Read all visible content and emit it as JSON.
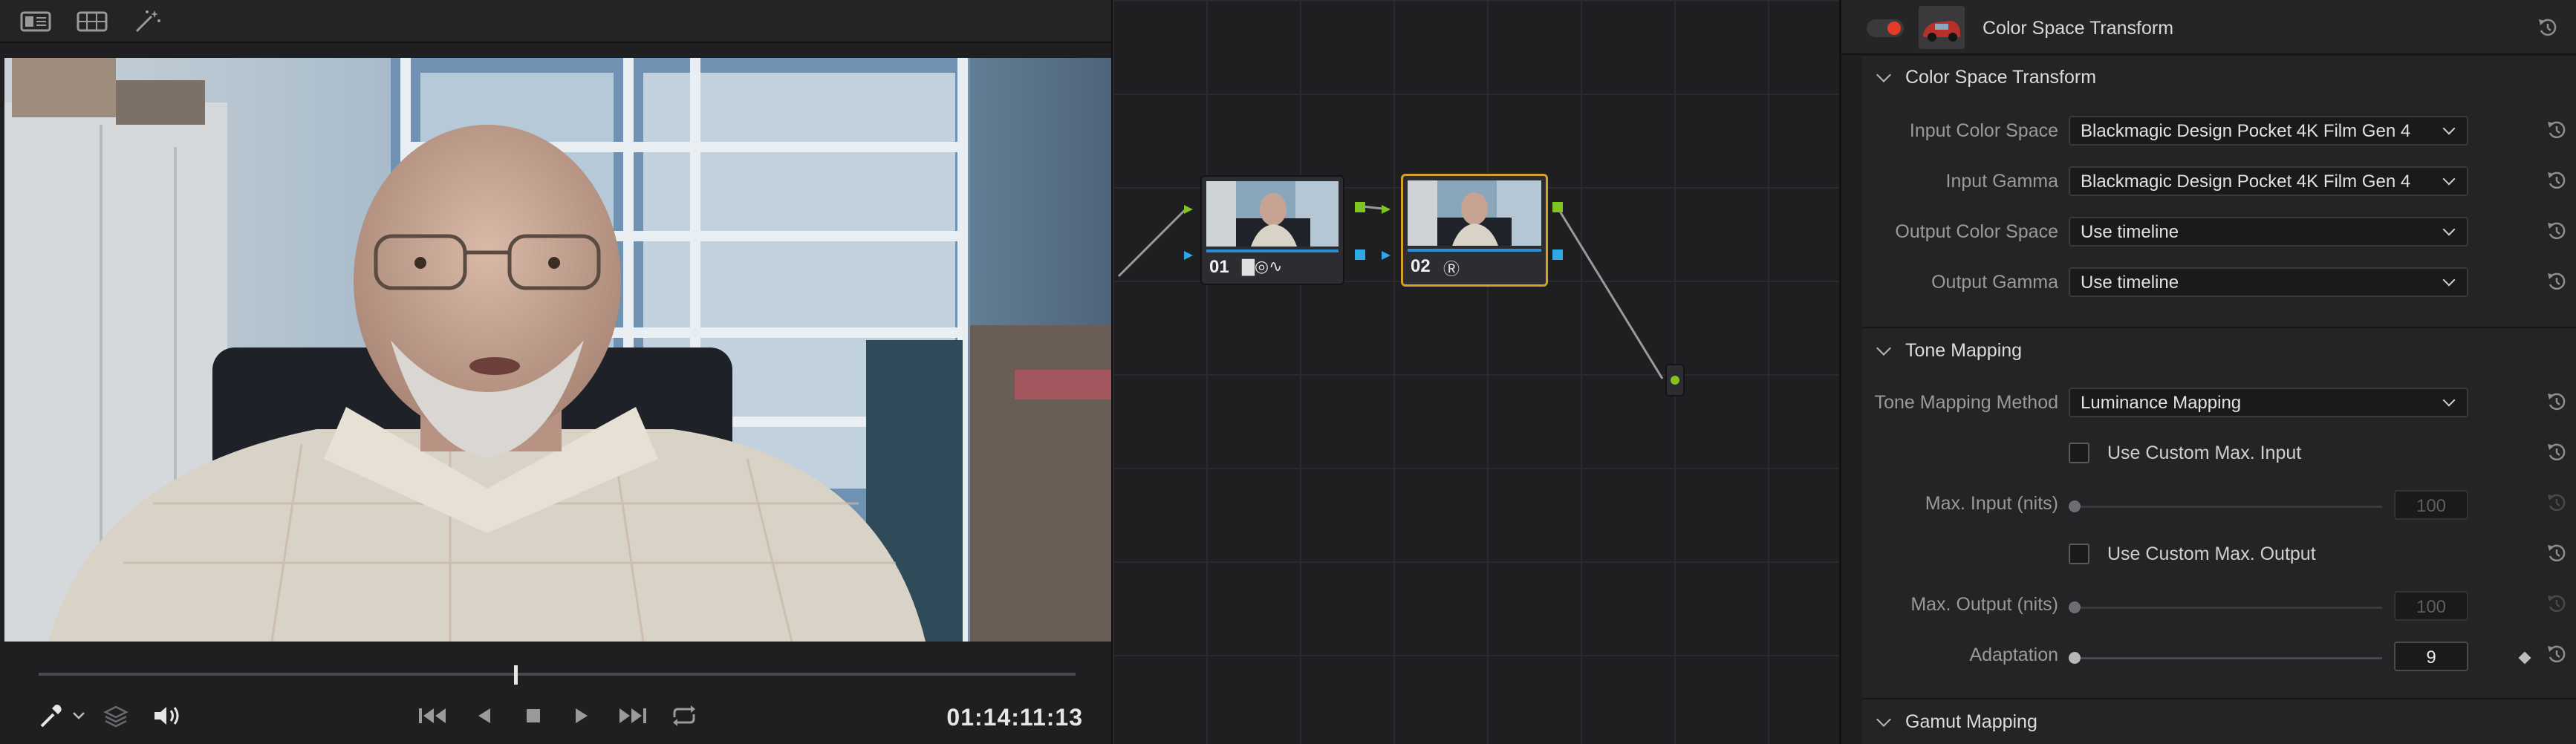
{
  "viewer": {
    "toolbar_icons": [
      "single-viewer-icon",
      "grid-viewer-icon",
      "magic-wand-icon"
    ],
    "timecode": "01:14:11:13",
    "transport_icons": [
      "eyedropper-icon",
      "layers-icon",
      "speaker-icon",
      "skip-to-start-icon",
      "step-back-icon",
      "stop-icon",
      "play-icon",
      "skip-to-end-icon",
      "loop-icon"
    ],
    "playhead_position": 0.46
  },
  "nodes": [
    {
      "label": "01",
      "icons": "▇◎∿",
      "selected": false
    },
    {
      "label": "02",
      "icons": "Ⓡ",
      "selected": true
    }
  ],
  "inspector": {
    "title": "Color Space Transform",
    "toggle_on": true,
    "sections": {
      "cst": {
        "title": "Color Space Transform",
        "input_color_space_label": "Input Color Space",
        "input_color_space_value": "Blackmagic Design Pocket 4K Film Gen 4",
        "input_gamma_label": "Input Gamma",
        "input_gamma_value": "Blackmagic Design Pocket 4K Film Gen 4",
        "output_color_space_label": "Output Color Space",
        "output_color_space_value": "Use timeline",
        "output_gamma_label": "Output Gamma",
        "output_gamma_value": "Use timeline"
      },
      "tone": {
        "title": "Tone Mapping",
        "method_label": "Tone Mapping Method",
        "method_value": "Luminance Mapping",
        "custom_max_input_label": "Use Custom Max. Input",
        "max_input_label": "Max. Input (nits)",
        "max_input_value": "100",
        "custom_max_output_label": "Use Custom Max. Output",
        "max_output_label": "Max. Output (nits)",
        "max_output_value": "100",
        "adaptation_label": "Adaptation",
        "adaptation_value": "9"
      },
      "gamut": {
        "title": "Gamut Mapping"
      }
    },
    "accent_color": "#d4a22a",
    "toggle_color": "#e63a2a"
  }
}
